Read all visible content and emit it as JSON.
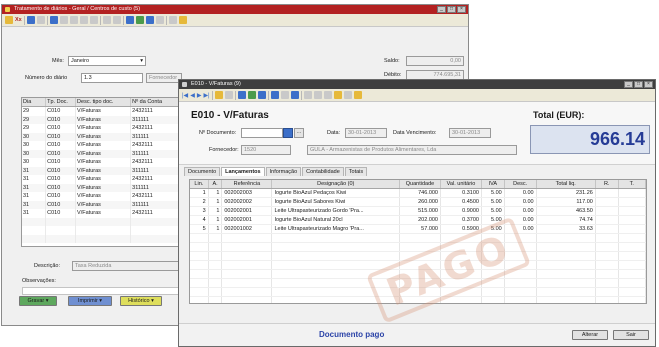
{
  "colors": {
    "back_title": "#b32121",
    "front_title": "#3e3e3e",
    "total_value": "#263c96",
    "status_text": "#2c44a8"
  },
  "back_window": {
    "title": "Tratamento de diários - Geral / Centros de custo (5)",
    "toolbar": {
      "menu_label": "Xx"
    },
    "mes_label": "Mês:",
    "mes_value": "Janeiro",
    "numero_label": "Número do diário",
    "numero_value": "1.3",
    "numero_desc": "Fornecedor",
    "saldo_label": "Saldo:",
    "saldo_value": "0,00",
    "debito_label": "Débito:",
    "debito_value": "774.695,31",
    "list": {
      "columns": [
        "Dia",
        "Tp. Doc.",
        "Desc. tipo doc.",
        "Nº da Conta"
      ],
      "rows": [
        [
          "29",
          "C010",
          "V/Faturas",
          "2432111"
        ],
        [
          "29",
          "C010",
          "V/Faturas",
          "311111"
        ],
        [
          "29",
          "C010",
          "V/Faturas",
          "2432111"
        ],
        [
          "30",
          "C010",
          "V/Faturas",
          "311111"
        ],
        [
          "30",
          "C010",
          "V/Faturas",
          "2432111"
        ],
        [
          "30",
          "C010",
          "V/Faturas",
          "311111"
        ],
        [
          "30",
          "C010",
          "V/Faturas",
          "2432111"
        ],
        [
          "31",
          "C010",
          "V/Faturas",
          "311111"
        ],
        [
          "31",
          "C010",
          "V/Faturas",
          "2432111"
        ],
        [
          "31",
          "C010",
          "V/Faturas",
          "311111"
        ],
        [
          "31",
          "C010",
          "V/Faturas",
          "2432111"
        ],
        [
          "31",
          "C010",
          "V/Faturas",
          "311111"
        ],
        [
          "31",
          "C010",
          "V/Faturas",
          "2432111"
        ]
      ]
    },
    "descricao_label": "Descrição:",
    "descricao_value": "Taxa Reduzida",
    "observacoes_label": "Observações:",
    "buttons": [
      "Gravar",
      "Imprimir",
      "Histórico"
    ]
  },
  "front_window": {
    "title": "E010 - V/Faturas (9)",
    "heading": "E010 - V/Faturas",
    "total_label": "Total (EUR):",
    "total_value": "966.14",
    "documento_label": "Nº Documento:",
    "documento_value": "",
    "ellipsis_label": "...",
    "data_label": "Data:",
    "data_value": "30-01-2013",
    "vencimento_label": "Data Vencimento:",
    "vencimento_value": "30-01-2013",
    "fornecedor_label": "Fornecedor:",
    "fornecedor_code": "1520",
    "fornecedor_name": "GULA - Armazenistas de Produtos Alimentares, Lda",
    "tabs": [
      "Documento",
      "Lançamentos",
      "Informação",
      "Contabilidade",
      "Totais"
    ],
    "active_tab": 1,
    "grid": {
      "columns": [
        "Lin.",
        "A.",
        "Referência",
        "Designação (0)",
        "Quantidade",
        "Val. unitário",
        "IVA",
        "Desc.",
        "Total liq.",
        "R.",
        "T."
      ],
      "rows": [
        [
          "1",
          "1",
          "002002003",
          "Iogurte BioAzul Pedaços Kiwi",
          "746.000",
          "0.3100",
          "5.00",
          "0.00",
          "231.26"
        ],
        [
          "2",
          "1",
          "002002002",
          "Iogurte BioAzul Sabores Kiwi",
          "260.000",
          "0.4500",
          "5.00",
          "0.00",
          "117.00"
        ],
        [
          "3",
          "1",
          "002002001",
          "Leite Ultrapasteurizado Gordo 'Pra...",
          "515.000",
          "0.9000",
          "5.00",
          "0.00",
          "463.50"
        ],
        [
          "4",
          "1",
          "002002001",
          "Iogurte BioAzul Natural 20cl",
          "202.000",
          "0.3700",
          "5.00",
          "0.00",
          "74.74"
        ],
        [
          "5",
          "1",
          "002001002",
          "Leite Ultrapasteurizado Magro 'Pra...",
          "57.000",
          "0.5900",
          "5.00",
          "0.00",
          "33.63"
        ]
      ]
    },
    "watermark": "PAGO",
    "status_text": "Documento pago",
    "alterar_label": "Alterar",
    "sair_label": "Sair"
  }
}
